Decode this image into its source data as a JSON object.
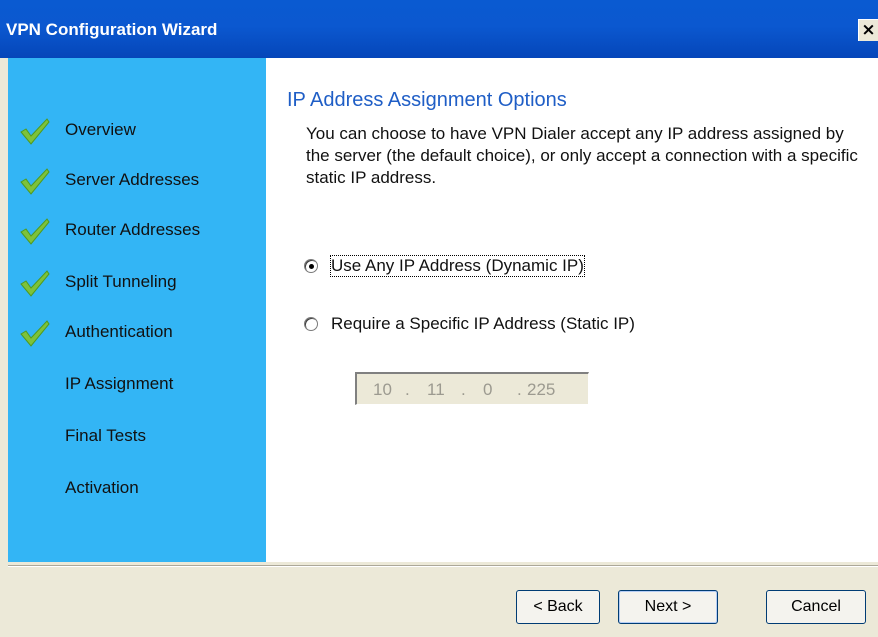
{
  "window": {
    "title": "VPN Configuration Wizard",
    "close_glyph": "×"
  },
  "sidebar": {
    "items": [
      {
        "label": "Overview",
        "done": true
      },
      {
        "label": "Server Addresses",
        "done": true
      },
      {
        "label": "Router Addresses",
        "done": true
      },
      {
        "label": "Split Tunneling",
        "done": true
      },
      {
        "label": "Authentication",
        "done": true
      },
      {
        "label": "IP Assignment",
        "done": false
      },
      {
        "label": "Final Tests",
        "done": false
      },
      {
        "label": "Activation",
        "done": false
      }
    ],
    "check_icon": "checkmark-icon",
    "check_color": "#7dc23a"
  },
  "main": {
    "heading": "IP Address Assignment Options",
    "description": "You can choose to have VPN Dialer accept any IP address assigned by the server (the default choice), or only accept a connection with a specific static IP address.",
    "options": [
      {
        "label": "Use Any IP Address (Dynamic IP)",
        "selected": true
      },
      {
        "label": "Require a Specific IP Address (Static IP)",
        "selected": false
      }
    ],
    "static_ip": {
      "octets": [
        "10",
        "11",
        "0",
        "225"
      ],
      "enabled": false
    }
  },
  "footer": {
    "back_label": "< Back",
    "next_label": "Next >",
    "cancel_label": "Cancel"
  },
  "colors": {
    "titlebar": "#0b58d0",
    "sidebar": "#33b5f5",
    "heading": "#1f5ec6"
  }
}
